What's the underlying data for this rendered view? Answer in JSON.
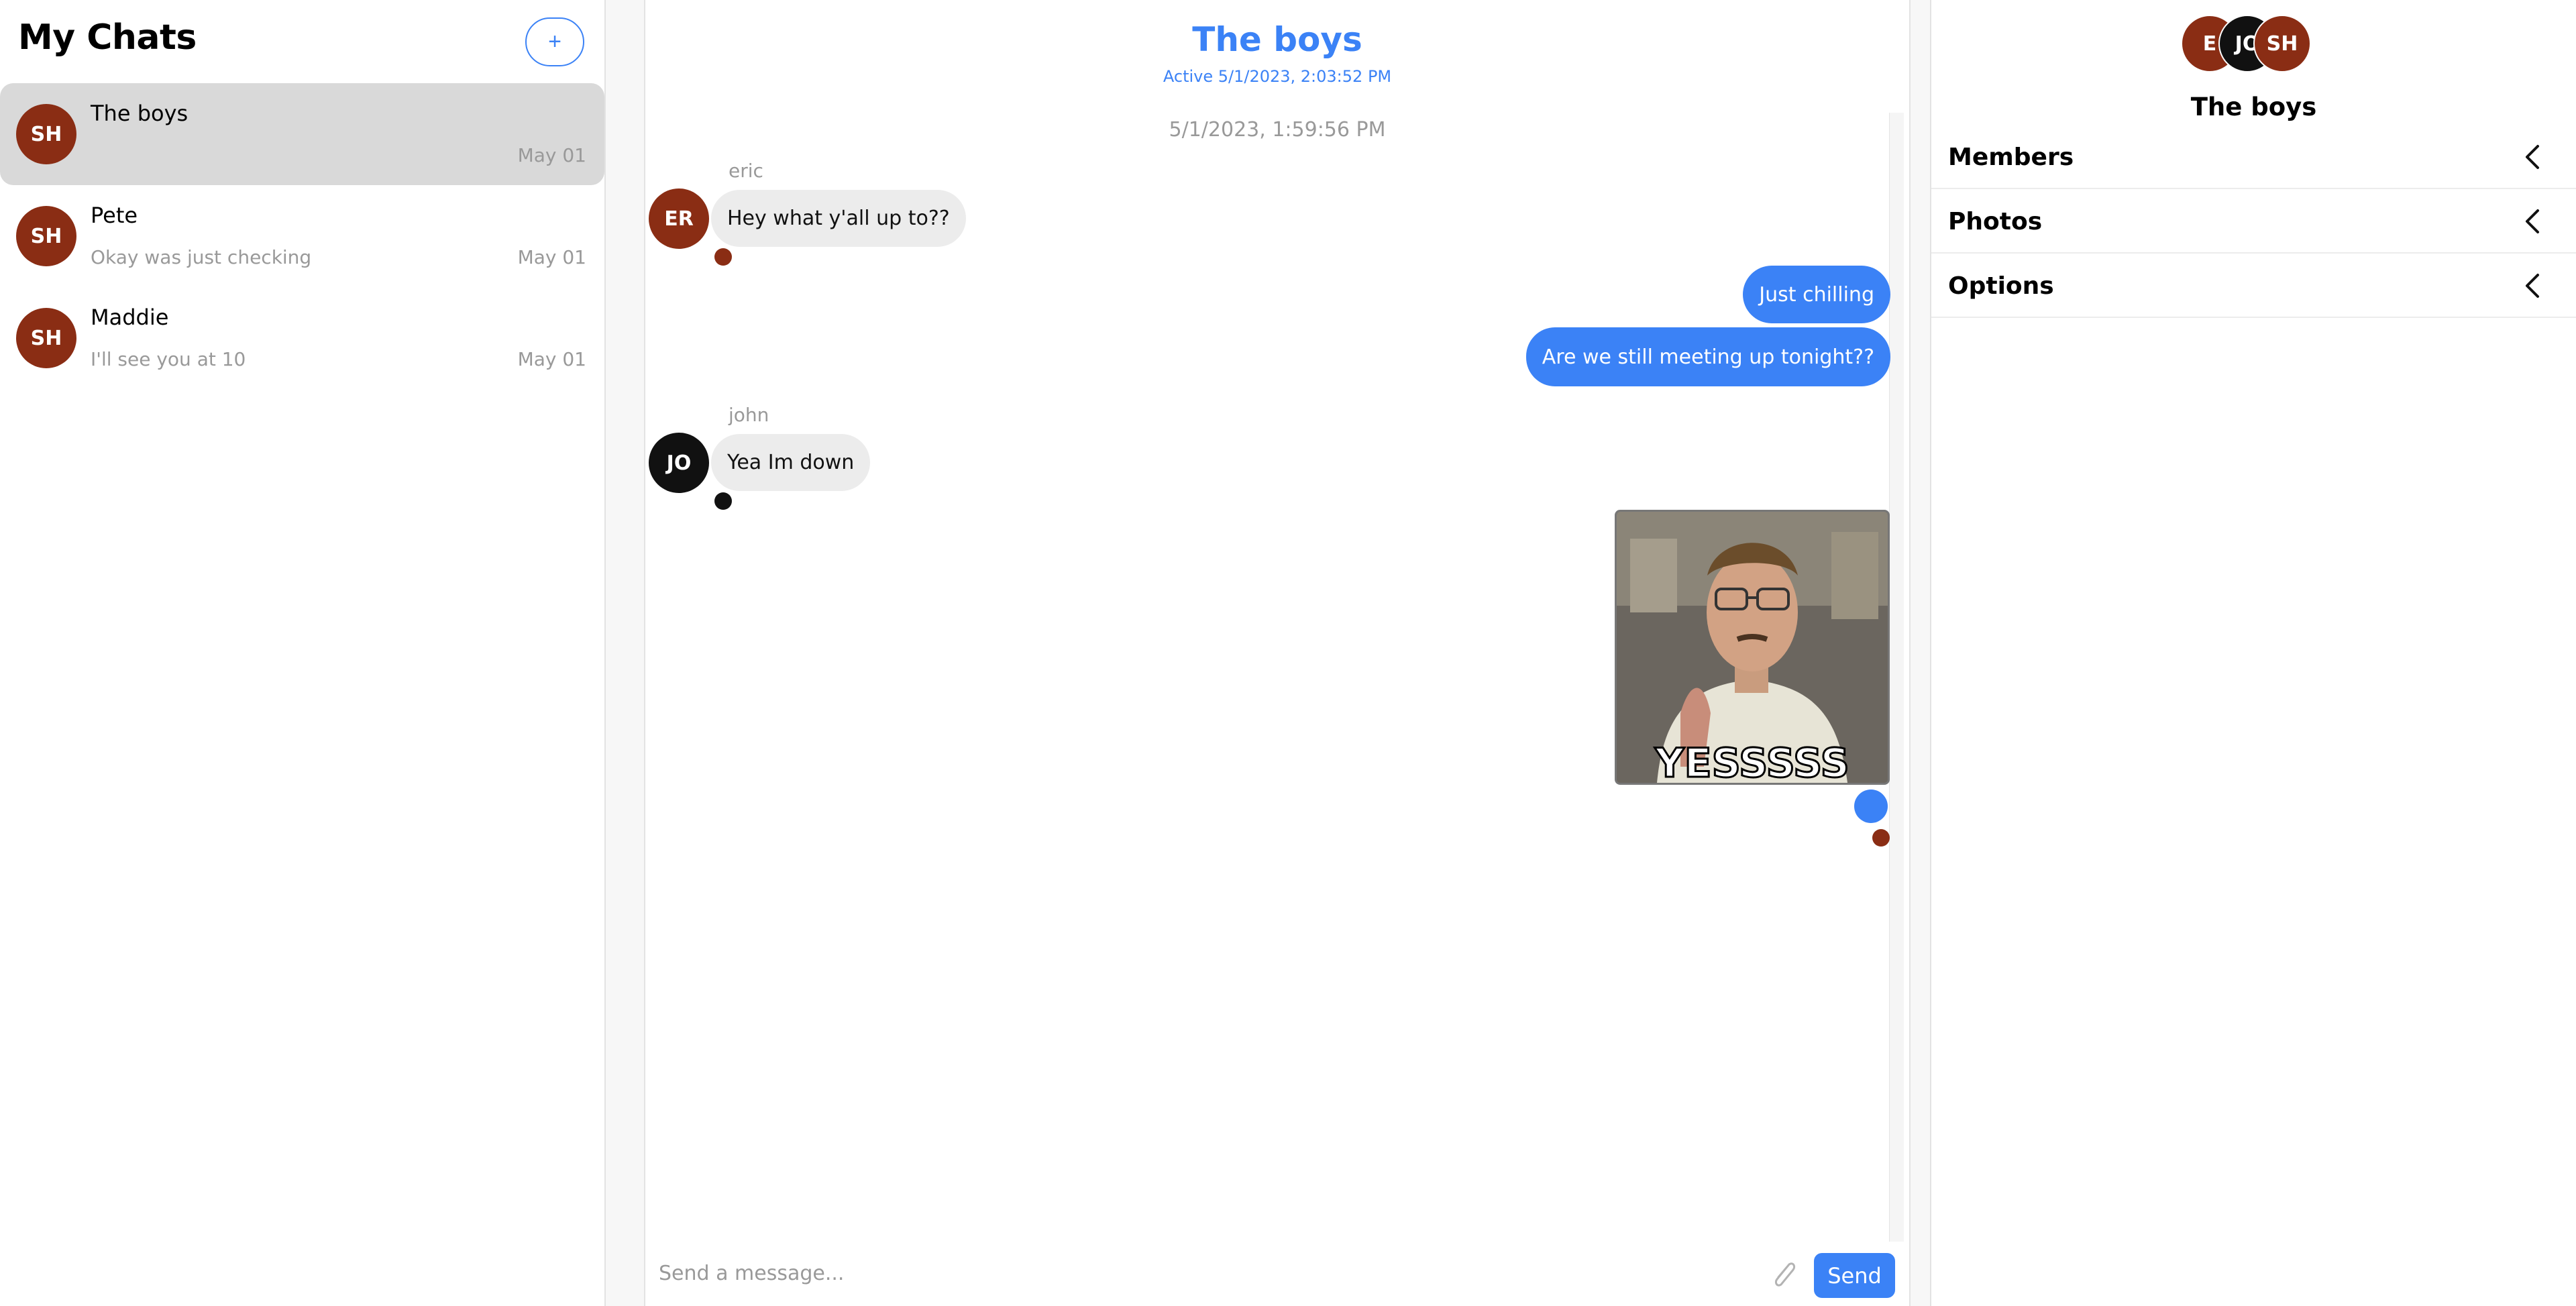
{
  "colors": {
    "accent": "#3b82f6",
    "avatar_brown": "#8a2d14",
    "avatar_black": "#111111",
    "active_chat_bg": "#d9d9d9",
    "incoming_bubble": "#ececec"
  },
  "sidebar": {
    "title": "My Chats",
    "new_chat_label": "+",
    "chats": [
      {
        "initials": "SH",
        "name": "The boys",
        "preview": "",
        "date": "May 01",
        "active": true
      },
      {
        "initials": "SH",
        "name": "Pete",
        "preview": "Okay was just checking",
        "date": "May 01",
        "active": false
      },
      {
        "initials": "SH",
        "name": "Maddie",
        "preview": "I'll see you at 10",
        "date": "May 01",
        "active": false
      }
    ]
  },
  "conversation": {
    "title": "The boys",
    "status": "Active 5/1/2023, 2:03:52 PM",
    "timestamp": "5/1/2023, 1:59:56 PM",
    "messages": [
      {
        "sender": "eric",
        "initials": "ER",
        "text": "Hey what y'all up to??"
      },
      {
        "text": "Just chilling"
      },
      {
        "text": "Are we still meeting up tonight??"
      },
      {
        "sender": "john",
        "initials": "JO",
        "text": "Yea Im down"
      },
      {
        "gif_caption": "YESSSSS"
      }
    ],
    "composer": {
      "placeholder": "Send a message...",
      "attach_icon": "paperclip-icon",
      "send_label": "Send"
    }
  },
  "details": {
    "avatars": [
      "E",
      "JO",
      "SH"
    ],
    "group_name": "The boys",
    "sections": [
      {
        "label": "Members",
        "icon": "chevron-left-icon"
      },
      {
        "label": "Photos",
        "icon": "chevron-left-icon"
      },
      {
        "label": "Options",
        "icon": "chevron-left-icon"
      }
    ]
  }
}
